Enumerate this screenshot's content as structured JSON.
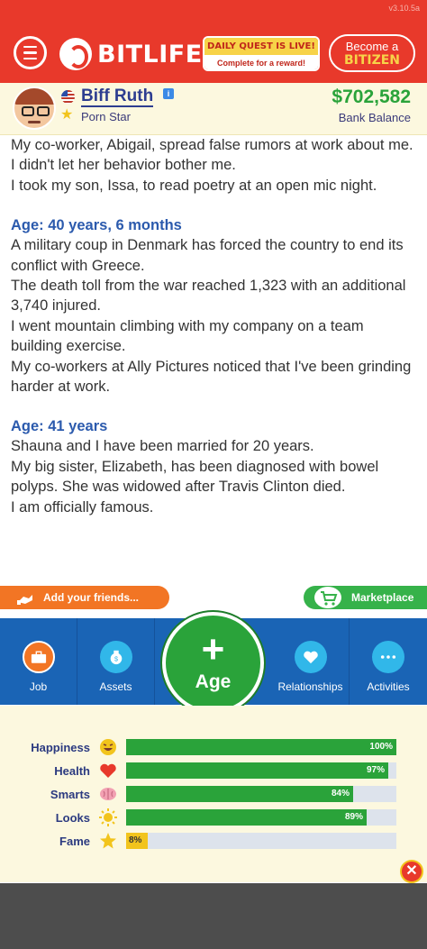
{
  "header": {
    "version": "v3.10.5a",
    "logo_text": "BITLIFE",
    "quest_title": "DAILY QUEST IS LIVE!",
    "quest_sub": "Complete for a reward!",
    "bitizen_l1": "Become a",
    "bitizen_l2": "BITIZEN"
  },
  "profile": {
    "name": "Biff Ruth",
    "occupation": "Porn Star",
    "balance": "$702,582",
    "balance_label": "Bank Balance"
  },
  "log": {
    "intro": [
      "My co-worker, Abigail, spread false rumors at work about me. I didn't let her behavior bother me.",
      "I took my son, Issa, to read poetry at an open mic night."
    ],
    "sections": [
      {
        "heading": "Age: 40 years, 6 months",
        "lines": [
          "A military coup in Denmark has forced the country to end its conflict with Greece.",
          "The death toll from the war reached 1,323 with an additional 3,740 injured.",
          "I went mountain climbing with my company on a team building exercise.",
          "My co-workers at Ally Pictures noticed that I've been grinding harder at work."
        ]
      },
      {
        "heading": "Age: 41 years",
        "lines": [
          "Shauna and I have been married for 20 years.",
          "My big sister, Elizabeth, has been diagnosed with bowel polyps. She was widowed after Travis Clinton died.",
          "I am officially famous."
        ]
      }
    ]
  },
  "actions": {
    "friends": "Add your friends...",
    "marketplace": "Marketplace"
  },
  "nav": {
    "job": "Job",
    "assets": "Assets",
    "age": "Age",
    "relationships": "Relationships",
    "activities": "Activities"
  },
  "stats": [
    {
      "label": "Happiness",
      "value": 100,
      "text": "100%",
      "icon": "grin-emoji-icon"
    },
    {
      "label": "Health",
      "value": 97,
      "text": "97%",
      "icon": "heart-icon"
    },
    {
      "label": "Smarts",
      "value": 84,
      "text": "84%",
      "icon": "brain-icon"
    },
    {
      "label": "Looks",
      "value": 89,
      "text": "89%",
      "icon": "sun-icon"
    },
    {
      "label": "Fame",
      "value": 8,
      "text": "8%",
      "icon": "star-icon"
    }
  ],
  "colors": {
    "brand_red": "#e8392b",
    "nav_blue": "#1a64b5",
    "stat_green": "#2aa33a",
    "stat_yellow": "#f2c41c"
  }
}
